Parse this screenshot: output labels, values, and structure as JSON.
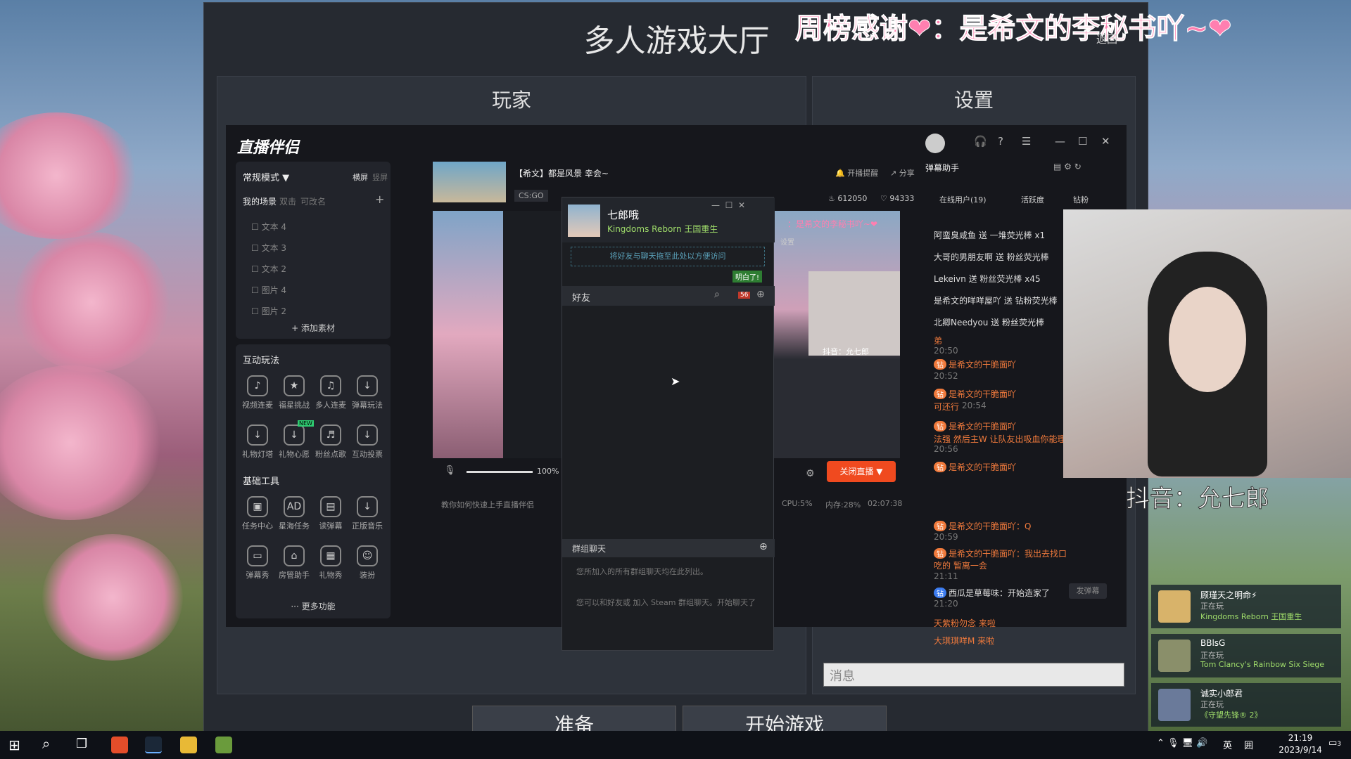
{
  "overlay": {
    "thanks": "周榜感谢❤：是希文的李秘书吖~❤",
    "handle": "抖音：允七郎"
  },
  "lobby": {
    "title": "多人游戏大厅",
    "back": "返回",
    "players_tab": "玩家",
    "settings_tab": "设置",
    "ready": "准备",
    "start": "开始游戏",
    "message_placeholder": "消息"
  },
  "app": {
    "logo": "直播伴侣",
    "mode": "常规模式 ▼",
    "landscape": "横屏",
    "portrait": "竖屏",
    "scene_tabs": [
      "我的场景",
      "双击",
      "可改名"
    ],
    "scenes": [
      "文本 4",
      "文本 3",
      "文本 2",
      "图片 4",
      "图片 2"
    ],
    "add_material": "+ 添加素材",
    "interactive_title": "互动玩法",
    "interactive": [
      "视频连麦",
      "福星挑战",
      "多人连麦",
      "弹幕玩法",
      "礼物灯塔",
      "礼物心愿",
      "粉丝点歌",
      "互动投票"
    ],
    "new_badge": "NEW",
    "tools_title": "基础工具",
    "tools": [
      "任务中心",
      "星海任务",
      "读弹幕",
      "正版音乐",
      "弹幕秀",
      "房管助手",
      "礼物秀",
      "装扮"
    ],
    "more": "··· 更多功能",
    "stream_title": "【希文】都是风景 幸会~",
    "game_tag": "CS:GO",
    "remind": "开播提醒",
    "share": "分享",
    "likes": "612050",
    "hearts": "94333",
    "volume": "100%",
    "close_live": "关闭直播 ▼",
    "hint": "教你如何快速上手直播伴侣",
    "cpu": "CPU:5%",
    "mem": "内存:28%",
    "time": "02:07:38",
    "danmu_title": "弹幕助手",
    "tab_online": "在线用户(19)",
    "tab_active": "活跃度",
    "tab_diamond": "钻粉",
    "gifts": [
      "阿蛮臭咸鱼 送 一堆荧光棒 x1",
      "大哥的男朋友啊 送 粉丝荧光棒",
      "Lekeivn 送 粉丝荧光棒 x45",
      "是希文的咩咩屋吖 送 钻粉荧光棒",
      "北卿Needyou 送 粉丝荧光棒"
    ],
    "chats": [
      "是希文的干脆面吖",
      "是希文的干脆面吖",
      "是希文的干脆面吖",
      "是希文的干脆面吖",
      "是希文的干脆面吖：Q",
      "是希文的干脆面吖：我出去找口吃的 暂离一会",
      "西瓜是草莓味：开始造家了"
    ],
    "chat_times": [
      "20:50",
      "20:52",
      "20:54",
      "20:56",
      "20:59",
      "21:11",
      "21:20"
    ],
    "chat_extra": [
      "可还行",
      "法强 然后主W 让队友出吸血你能理",
      "弟"
    ],
    "arrivals": [
      "天紫粉勿念 来啦",
      "大琪琪咩M 来啦"
    ],
    "send_danmu": "发弹幕",
    "preview_thanks": "：是希文的李秘书吖~❤",
    "preview_handle": "抖音：允七郎",
    "preview_settings": "设置"
  },
  "steam_friends": {
    "name": "七郎哦",
    "game": "Kingdoms Reborn 王国重生",
    "tip": "将好友与聊天拖至此处以方便访问",
    "got_it": "明白了!",
    "friends_label": "好友",
    "badge": "56",
    "group_label": "群组聊天",
    "group_empty": "您所加入的所有群组聊天均在此列出。",
    "group_join": "您可以和好友或 加入 Steam 群组聊天。开始聊天了"
  },
  "online_friends": [
    {
      "name": "顾瑾天之明命⚡",
      "status": "正在玩",
      "game": "Kingdoms Reborn 王国重生"
    },
    {
      "name": "BBlsG",
      "status": "正在玩",
      "game": "Tom Clancy's Rainbow Six Siege"
    },
    {
      "name": "诚实小郎君",
      "status": "正在玩",
      "game": "《守望先锋® 2》"
    }
  ],
  "taskbar": {
    "time": "21:19",
    "date": "2023/9/14",
    "ime": "英",
    "ime2": "囲",
    "notify": "3"
  }
}
